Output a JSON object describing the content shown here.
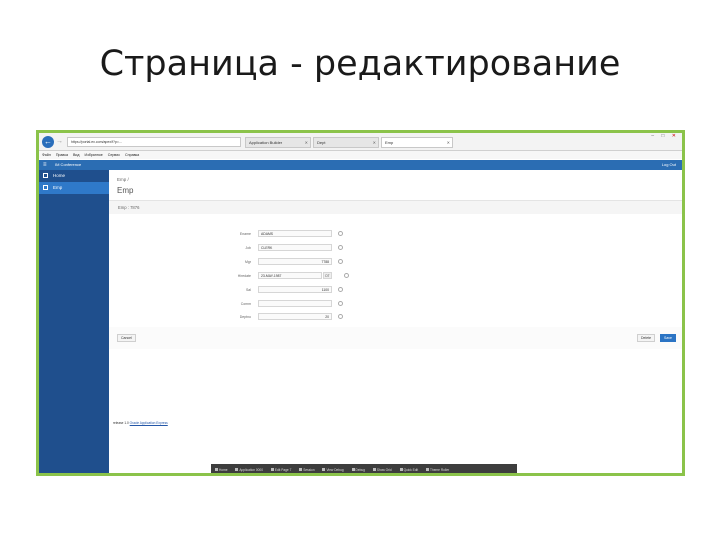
{
  "slide": {
    "title": "Страница - редактирование"
  },
  "browser": {
    "address": "https://portal.ex.com/apex/f?p=...",
    "tabs": [
      {
        "label": "Application Builder"
      },
      {
        "label": "Dept"
      },
      {
        "label": "Emp"
      }
    ],
    "window_controls": {
      "minimize": "–",
      "maximize": "□",
      "close": "✕"
    },
    "menu": [
      "Файл",
      "Правка",
      "Вид",
      "Избранное",
      "Сервис",
      "Справка"
    ]
  },
  "app": {
    "name": "IM Conference",
    "user": "Log Out"
  },
  "sidebar": {
    "items": [
      {
        "label": "Home",
        "active": false
      },
      {
        "label": "Emp",
        "active": true
      }
    ]
  },
  "page": {
    "breadcrumb": "Emp /",
    "title": "Emp",
    "record_label": "Emp : 7876"
  },
  "form": {
    "fields": [
      {
        "label": "Ename",
        "value": "ADAMS",
        "type": "text"
      },
      {
        "label": "Job",
        "value": "CLERK",
        "type": "text"
      },
      {
        "label": "Mgr",
        "value": "7788",
        "type": "number"
      },
      {
        "label": "Hiredate",
        "value": "23-MAY-1987",
        "type": "date",
        "picker": "DT"
      },
      {
        "label": "Sal",
        "value": "1100",
        "type": "number"
      },
      {
        "label": "Comm",
        "value": "",
        "type": "number"
      },
      {
        "label": "Deptno",
        "value": "20",
        "type": "number"
      }
    ]
  },
  "buttons": {
    "cancel": "Cancel",
    "delete": "Delete",
    "save": "Save"
  },
  "status": {
    "prefix": "release 1.0",
    "link": "Oracle Application Express"
  },
  "devtools": [
    "Home",
    "Application 0000",
    "Edit Page 7",
    "Session",
    "View Debug",
    "Debug",
    "Show Grid",
    "Quick Edit",
    "Theme Roller"
  ],
  "colors": {
    "accent": "#2b6db3",
    "sidebar": "#1f4f8d",
    "sidebar_active": "#2f79c9",
    "frame": "#8bc34a"
  }
}
